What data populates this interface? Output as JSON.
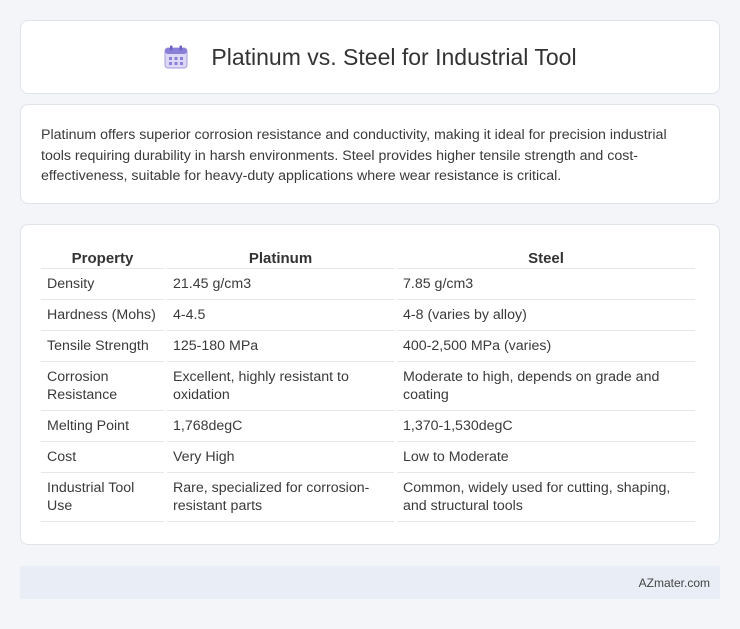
{
  "header": {
    "title": "Platinum vs. Steel for Industrial Tool",
    "icon": "calendar-icon"
  },
  "intro": {
    "text": "Platinum offers superior corrosion resistance and conductivity, making it ideal for precision industrial tools requiring durability in harsh environments. Steel provides higher tensile strength and cost-effectiveness, suitable for heavy-duty applications where wear resistance is critical."
  },
  "table": {
    "headers": [
      "Property",
      "Platinum",
      "Steel"
    ],
    "rows": [
      [
        "Density",
        "21.45 g/cm3",
        "7.85 g/cm3"
      ],
      [
        "Hardness (Mohs)",
        "4-4.5",
        "4-8 (varies by alloy)"
      ],
      [
        "Tensile Strength",
        "125-180 MPa",
        "400-2,500 MPa (varies)"
      ],
      [
        "Corrosion Resistance",
        "Excellent, highly resistant to oxidation",
        "Moderate to high, depends on grade and coating"
      ],
      [
        "Melting Point",
        "1,768degC",
        "1,370-1,530degC"
      ],
      [
        "Cost",
        "Very High",
        "Low to Moderate"
      ],
      [
        "Industrial Tool Use",
        "Rare, specialized for corrosion-resistant parts",
        "Common, widely used for cutting, shaping, and structural tools"
      ]
    ]
  },
  "footer": {
    "text": "AZmater.com"
  },
  "colors": {
    "background": "#f3f5f9",
    "card": "#ffffff",
    "footer": "#e8edf6",
    "icon_accent": "#8a7fd6"
  }
}
